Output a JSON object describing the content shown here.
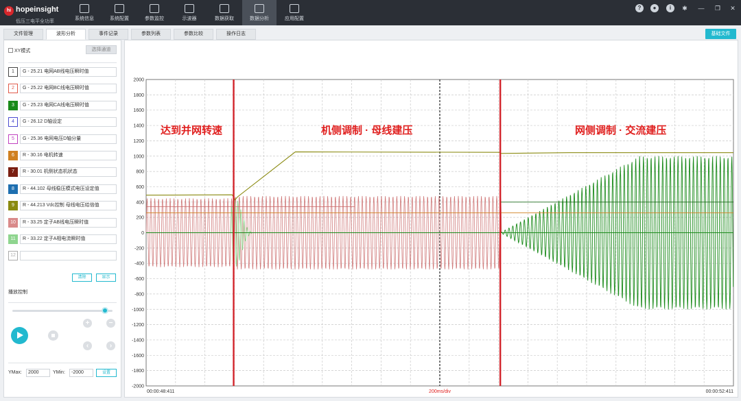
{
  "app": {
    "brand": "hopeinsight",
    "subtitle": "低压三电平全功率"
  },
  "nav": [
    {
      "label": "系统信息",
      "icon": "monitor-icon"
    },
    {
      "label": "系统配置",
      "icon": "document-gear-icon"
    },
    {
      "label": "参数监控",
      "icon": "pulse-icon"
    },
    {
      "label": "示波器",
      "icon": "oscilloscope-icon"
    },
    {
      "label": "数据获取",
      "icon": "folder-download-icon"
    },
    {
      "label": "数据分析",
      "icon": "folder-chart-icon"
    },
    {
      "label": "应用配置",
      "icon": "app-config-icon"
    }
  ],
  "nav_active": 5,
  "tabs": [
    {
      "label": "文件管理"
    },
    {
      "label": "波形分析"
    },
    {
      "label": "事件记录"
    },
    {
      "label": "参数列表"
    },
    {
      "label": "参数比较"
    },
    {
      "label": "操作日志"
    }
  ],
  "tab_active": 1,
  "export_label": "基础文件",
  "left": {
    "xy_label": "XY模式",
    "select_channel": "选择通道",
    "channels": [
      {
        "num": "1",
        "name": "G - 25.21 电网AB线电压瞬时值",
        "color": "#444444",
        "filled": false
      },
      {
        "num": "2",
        "name": "G - 25.22 电网BC线电压瞬时值",
        "color": "#e05a4a",
        "filled": false
      },
      {
        "num": "3",
        "name": "G - 25.23 电网CA线电压瞬时值",
        "color": "#1a8a1a",
        "filled": true
      },
      {
        "num": "4",
        "name": "G - 26.12 D轴设定",
        "color": "#4b4bd0",
        "filled": false
      },
      {
        "num": "5",
        "name": "G - 25.36 电网电压D轴分量",
        "color": "#c040c0",
        "filled": false
      },
      {
        "num": "6",
        "name": "R - 30.16 电机转速",
        "color": "#d08020",
        "filled": true
      },
      {
        "num": "7",
        "name": "R - 30.01 机侧状态机状态",
        "color": "#7a1f12",
        "filled": true
      },
      {
        "num": "8",
        "name": "R - 44.102 母线稳压模式电压设定值",
        "color": "#1e6fb0",
        "filled": true
      },
      {
        "num": "9",
        "name": "R - 44.213 Vdc控制 母线电压给倍值",
        "color": "#8a8a10",
        "filled": true
      },
      {
        "num": "10",
        "name": "R - 33.25 定子AB线电压瞬时值",
        "color": "#d98a8a",
        "filled": true
      },
      {
        "num": "11",
        "name": "R - 33.22 定子A相电流瞬时值",
        "color": "#8fd58f",
        "filled": true
      },
      {
        "num": "12",
        "name": "",
        "color": "#aaaaaa",
        "filled": false
      }
    ],
    "clear_label": "清除",
    "show_label": "显示",
    "playback_title": "播放控制",
    "ymax_label": "YMax:",
    "ymax_value": "2000",
    "ymin_label": "YMin:",
    "ymin_value": "-2000",
    "apply_label": "设置"
  },
  "chart_data": {
    "type": "line",
    "ylim": [
      -2000,
      2000
    ],
    "yticks": [
      2000,
      1800,
      1600,
      1400,
      1200,
      1000,
      800,
      600,
      400,
      200,
      0,
      -200,
      -400,
      -600,
      -800,
      -1000,
      -1200,
      -1400,
      -1600,
      -1800,
      -2000
    ],
    "grid": true,
    "time_start": "00:00:48:411",
    "time_end": "00:00:52:411",
    "time_scale": "200ms/div",
    "annotations": [
      "达到并网转速",
      "机侧调制 · 母线建压",
      "网侧调制 · 交流建压"
    ],
    "colors": {
      "stator_voltage": "#c86464",
      "grid_voltage": "#1a8a1a",
      "stator_current": "#8fd58f",
      "dc_bus": "#8a8a10",
      "markers": "#d2232a"
    }
  }
}
